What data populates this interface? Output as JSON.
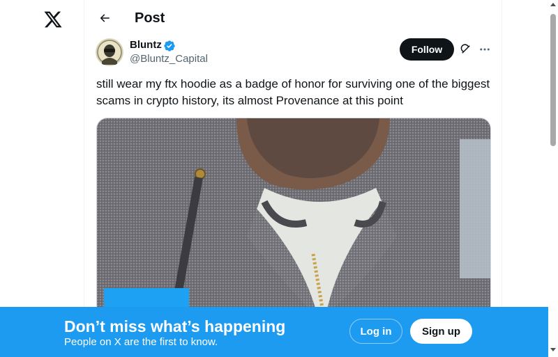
{
  "app": {
    "logo_icon": "x-logo-icon"
  },
  "header": {
    "title": "Post",
    "back_icon": "arrow-left-icon"
  },
  "post": {
    "author": {
      "name": "Bluntz",
      "handle": "@Bluntz_Capital",
      "verified": true,
      "verified_color": "#1d9bf0"
    },
    "follow_label": "Follow",
    "text": "still wear my ftx hoodie as a badge of honor for surviving one of the biggest scams in crypto history, its almost Provenance at this point",
    "media": {
      "type": "photo",
      "icons": [
        "hoodie-photo"
      ]
    }
  },
  "banner": {
    "title": "Don’t miss what’s happening",
    "subtitle": "People on X are the first to know.",
    "login_label": "Log in",
    "signup_label": "Sign up",
    "background": "#1d9bf0"
  },
  "icons": {
    "grok": "grok-icon",
    "more": "more-horizontal-icon"
  }
}
